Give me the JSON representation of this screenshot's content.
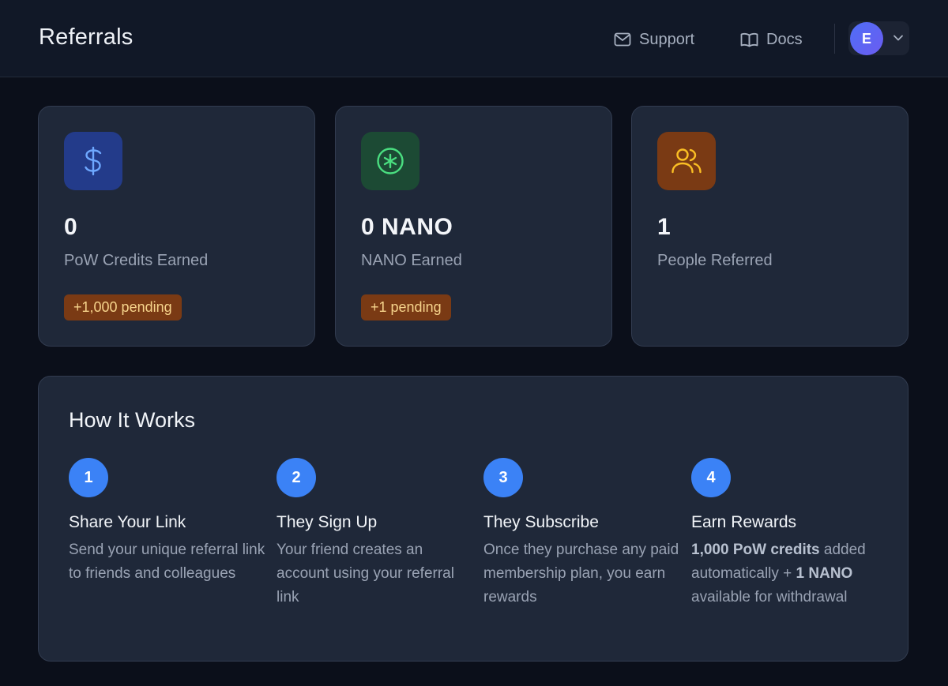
{
  "header": {
    "title": "Referrals",
    "support_label": "Support",
    "docs_label": "Docs",
    "avatar_initial": "E"
  },
  "stats": [
    {
      "icon": "dollar-icon",
      "value": "0",
      "label": "PoW Credits Earned",
      "pending": "+1,000 pending",
      "accent": "#6ea8ff",
      "icon_bg": "#233b8a"
    },
    {
      "icon": "asterisk-circle-icon",
      "value": "0 NANO",
      "label": "NANO Earned",
      "pending": "+1 pending",
      "accent": "#4ade80",
      "icon_bg": "#1c4a34"
    },
    {
      "icon": "users-icon",
      "value": "1",
      "label": "People Referred",
      "accent": "#fbbf24",
      "icon_bg": "#7a3a14"
    }
  ],
  "how_it_works": {
    "title": "How It Works",
    "steps": [
      {
        "number": "1",
        "title": "Share Your Link",
        "description": "Send your unique referral link to friends and colleagues"
      },
      {
        "number": "2",
        "title": "They Sign Up",
        "description": "Your friend creates an account using your referral link"
      },
      {
        "number": "3",
        "title": "They Subscribe",
        "description": "Once they purchase any paid membership plan, you earn rewards"
      },
      {
        "number": "4",
        "title": "Earn Rewards",
        "desc_bold_1": "1,000 PoW credits",
        "desc_text_1": " added automatically + ",
        "desc_bold_2": "1 NANO",
        "desc_text_2": " available for withdrawal"
      }
    ]
  },
  "colors": {
    "background": "#0b0f1a",
    "card": "#1f2839",
    "step_accent": "#3b82f6",
    "badge_bg": "#7a3a14",
    "badge_text": "#f6d38b"
  }
}
